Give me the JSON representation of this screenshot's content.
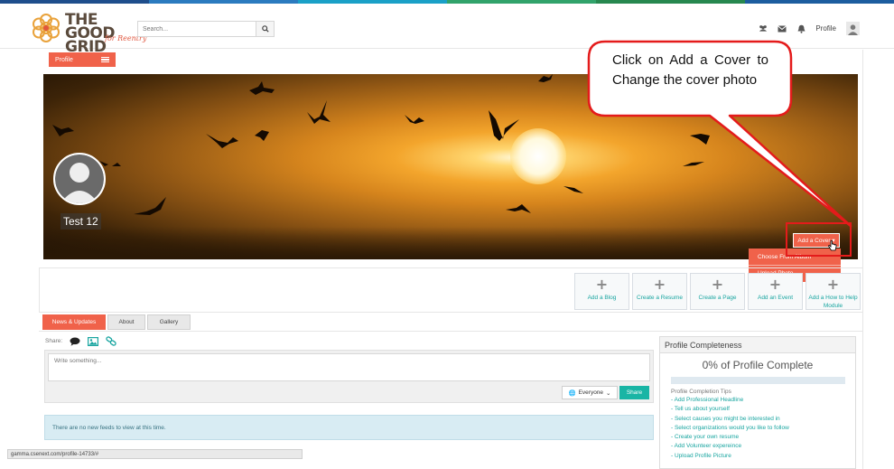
{
  "brand": {
    "logo_line1": "THE GOOD",
    "logo_line2": "GRID",
    "logo_tagline": "for Reentry",
    "strip_colors": [
      "#1f4e8c",
      "#2b7bbf",
      "#1aa0c7",
      "#31a36b",
      "#27884f",
      "#1c5d9f"
    ]
  },
  "header": {
    "search_placeholder": "Search...",
    "search_icon": "search-icon",
    "icons": [
      "users-icon",
      "envelope-icon",
      "bell-icon"
    ],
    "profile_label": "Profile",
    "avatar_icon": "user-icon"
  },
  "profile_menu": {
    "label": "Profile",
    "icon": "hamburger-icon"
  },
  "cover": {
    "user_name": "Test 12",
    "add_cover_label": "Add a Cover",
    "dropdown": [
      "Choose From Album",
      "Upload Photo"
    ]
  },
  "callout": {
    "text": "Click on Add a Cover to Change the cover photo",
    "color": "#e41b1b"
  },
  "actions": [
    {
      "label": "Add a Blog",
      "icon": "plus-icon"
    },
    {
      "label": "Create a Resume",
      "icon": "plus-icon"
    },
    {
      "label": "Create a Page",
      "icon": "plus-icon"
    },
    {
      "label": "Add an Event",
      "icon": "plus-icon"
    },
    {
      "label": "Add a How to Help Module",
      "icon": "plus-icon"
    }
  ],
  "tabs": [
    {
      "label": "News & Updates",
      "active": true
    },
    {
      "label": "About",
      "active": false
    },
    {
      "label": "Gallery",
      "active": false
    }
  ],
  "share": {
    "label": "Share:",
    "icons": [
      "comment-icon",
      "image-icon",
      "link-icon"
    ],
    "placeholder": "Write something...",
    "privacy": "Everyone",
    "share_button": "Share"
  },
  "feed": {
    "empty_message": "There are no new feeds to view at this time."
  },
  "completeness": {
    "title": "Profile Completeness",
    "percent_text": "0% of Profile Complete",
    "percent": 0,
    "tips_header": "Profile Completion Tips",
    "tips": [
      "- Add Professional Headline",
      "- Tell us about yourself",
      "- Select causes you might be interested in",
      "- Select organizations would you like to follow",
      "- Create your own resume",
      "- Add Volunteer expereince",
      "- Upload Profile Picture"
    ]
  },
  "status_bar": {
    "url": "gamma.csenext.com/profile-14733/#"
  },
  "colors": {
    "accent": "#f0624a",
    "teal": "#18a5a0",
    "share": "#19b5a5"
  }
}
